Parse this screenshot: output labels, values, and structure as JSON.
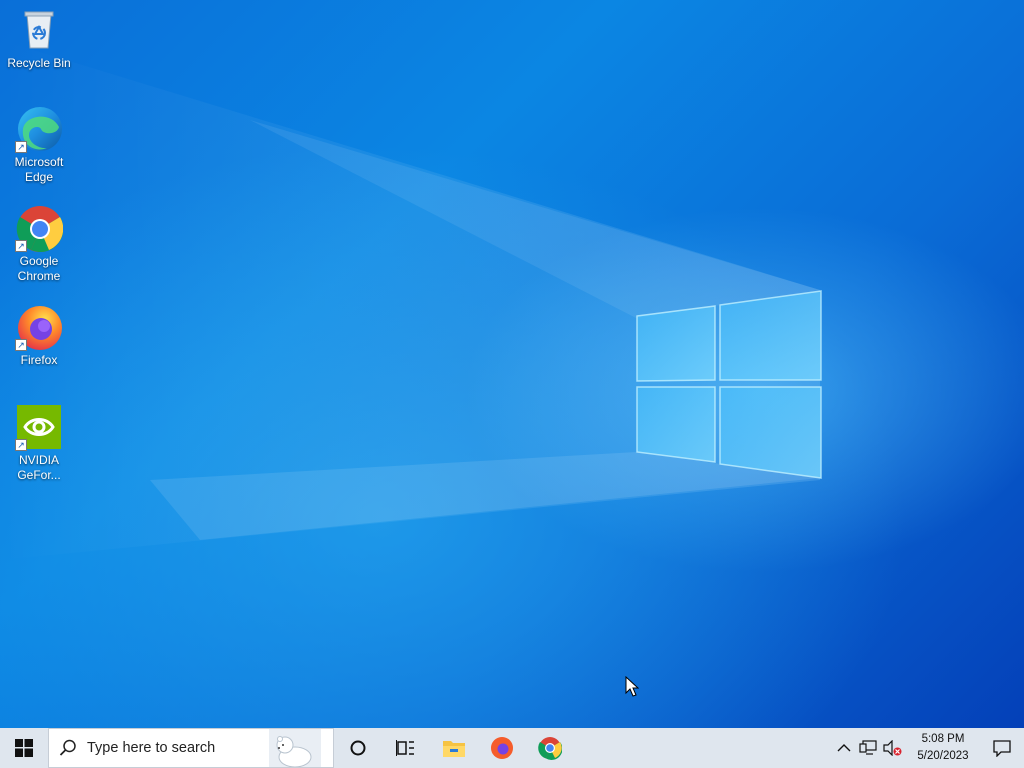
{
  "desktop": {
    "icons": [
      {
        "label": "Recycle Bin",
        "icon": "recycle-bin-icon"
      },
      {
        "label": "Microsoft Edge",
        "icon": "edge-icon"
      },
      {
        "label": "Google Chrome",
        "icon": "chrome-icon"
      },
      {
        "label": "Firefox",
        "icon": "firefox-icon"
      },
      {
        "label": "NVIDIA GeFor...",
        "icon": "nvidia-icon"
      }
    ]
  },
  "taskbar": {
    "search_placeholder": "Type here to search",
    "pinned": [
      "cortana-icon",
      "task-view-icon",
      "file-explorer-icon",
      "firefox-icon",
      "chrome-icon"
    ],
    "tray": [
      "show-hidden-icons",
      "network-icon",
      "volume-muted-icon"
    ],
    "clock": {
      "time": "5:08 PM",
      "date": "5/20/2023"
    }
  },
  "colors": {
    "desktop_blue": "#0a78dd",
    "taskbar": "#dfe6ee"
  }
}
